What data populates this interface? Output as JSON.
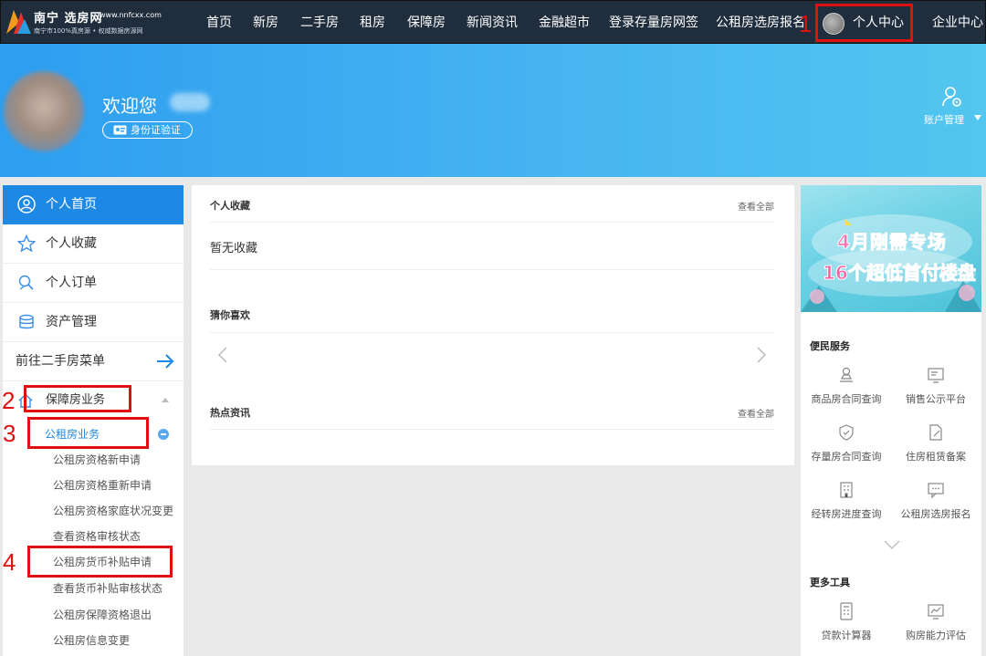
{
  "nav": {
    "logo_name": "南宁 选房网",
    "logo_url": "www.nnfcxx.com",
    "logo_tagline": "南宁市100%真房源 • 权威数据房源网",
    "items": [
      "首页",
      "新房",
      "二手房",
      "租房",
      "保障房",
      "新闻资讯",
      "金融超市",
      "登录存量房网签",
      "公租房选房报名",
      "个人中心",
      "企业中心"
    ]
  },
  "marks": [
    "1",
    "2",
    "3",
    "4"
  ],
  "banner": {
    "welcome": "欢迎您",
    "verify_label": "身份证验证",
    "account_label": "账户管理"
  },
  "sidebar": {
    "items": [
      "个人首页",
      "个人收藏",
      "个人订单",
      "资产管理"
    ],
    "goto_label": "前往二手房菜单",
    "section_label": "保障房业务",
    "sub_label": "公租房业务",
    "leaves": [
      "公租房资格新申请",
      "公租房资格重新申请",
      "公租房资格家庭状况变更",
      "查看资格审核状态",
      "公租房货币补贴申请",
      "查看货币补贴审核状态",
      "公租房保障资格退出",
      "公租房信息变更"
    ]
  },
  "center": {
    "favorites_title": "个人收藏",
    "view_all": "查看全部",
    "empty_text": "暂无收藏",
    "guess_title": "猜你喜欢",
    "news_title": "热点资讯"
  },
  "right": {
    "promo_line1": "4月刚需专场",
    "promo_line2": "16个超低首付楼盘",
    "services_title": "便民服务",
    "services": [
      "商品房合同查询",
      "销售公示平台",
      "存量房合同查询",
      "住房租赁备案",
      "经转房进度查询",
      "公租房选房报名"
    ],
    "tools_title": "更多工具",
    "tools": [
      "贷款计算器",
      "购房能力评估"
    ]
  },
  "colors": {
    "nav_bg": "#1f2d3d",
    "primary": "#1e88e5",
    "highlight": "#e01010"
  }
}
